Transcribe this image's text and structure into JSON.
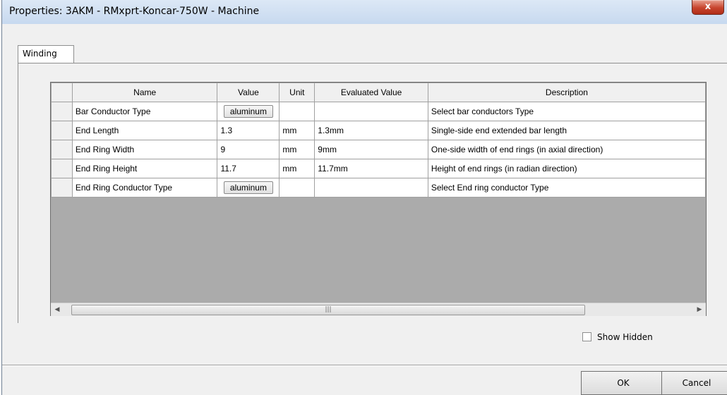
{
  "window": {
    "title": "Properties: 3AKM - RMxprt-Koncar-750W - Machine",
    "close_label": "x"
  },
  "tabs": [
    {
      "label": "Winding",
      "selected": true
    }
  ],
  "grid": {
    "columns": [
      "Name",
      "Value",
      "Unit",
      "Evaluated Value",
      "Description"
    ],
    "rows": [
      {
        "name": "Bar Conductor Type",
        "value": "aluminum",
        "value_is_button": true,
        "unit": "",
        "evaluated": "",
        "description": "Select bar conductors Type"
      },
      {
        "name": "End Length",
        "value": "1.3",
        "value_is_button": false,
        "unit": "mm",
        "evaluated": "1.3mm",
        "description": "Single-side end extended bar length"
      },
      {
        "name": "End Ring Width",
        "value": "9",
        "value_is_button": false,
        "unit": "mm",
        "evaluated": "9mm",
        "description": "One-side width of end rings (in axial direction)"
      },
      {
        "name": "End Ring Height",
        "value": "11.7",
        "value_is_button": false,
        "unit": "mm",
        "evaluated": "11.7mm",
        "description": "Height of  end rings (in radian direction)"
      },
      {
        "name": "End Ring Conductor Type",
        "value": "aluminum",
        "value_is_button": true,
        "unit": "",
        "evaluated": "",
        "description": "Select End ring conductor Type"
      }
    ]
  },
  "show_hidden": {
    "label": "Show Hidden",
    "checked": false
  },
  "buttons": {
    "ok": "OK",
    "cancel": "Cancel"
  }
}
